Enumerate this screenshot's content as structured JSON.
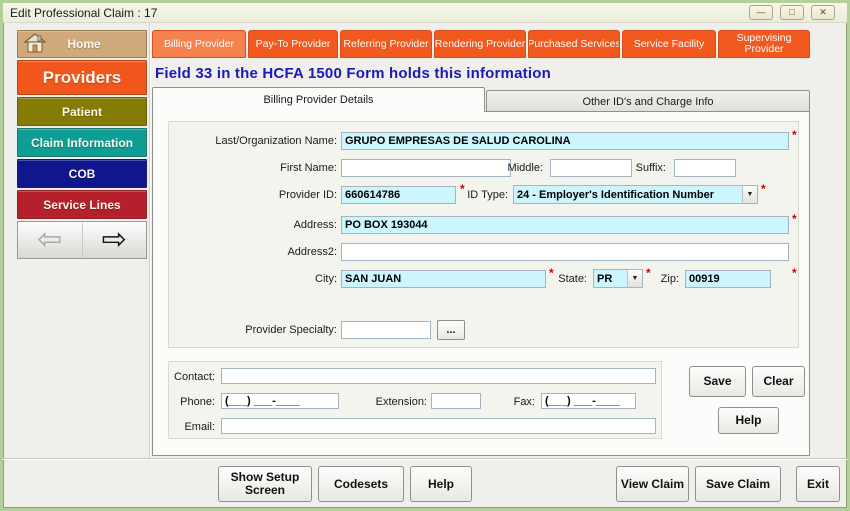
{
  "window": {
    "title": "Edit Professional Claim : 17"
  },
  "icons": {
    "minimize": "—",
    "maximize": "□",
    "close": "✕",
    "back": "⇦",
    "forward": "⇨",
    "dropdown": "▼",
    "home": "home-icon"
  },
  "theme": {
    "tab_active": "#f5814f",
    "tab_inactive": "#f2591e",
    "field_filled": "#ccf5fd",
    "required_color": "#cc0000",
    "note_color": "#1a1ab8"
  },
  "sidebar": {
    "items": [
      {
        "label": "Home",
        "color": "#cfa979"
      },
      {
        "label": "Providers",
        "color": "#f1571c"
      },
      {
        "label": "Patient",
        "color": "#847c04"
      },
      {
        "label": "Claim Information",
        "color": "#0f9e95"
      },
      {
        "label": "COB",
        "color": "#10168e"
      },
      {
        "label": "Service Lines",
        "color": "#b5202c"
      }
    ]
  },
  "provider_tabs": [
    {
      "label": "Billing Provider"
    },
    {
      "label": "Pay-To Provider"
    },
    {
      "label": "Referring Provider"
    },
    {
      "label": "Rendering Provider"
    },
    {
      "label": "Purchased Services"
    },
    {
      "label": "Service Facility"
    },
    {
      "label": "Supervising Provider"
    }
  ],
  "note": "Field 33 in the HCFA 1500 Form holds this information",
  "detail_tabs": [
    {
      "label": "Billing Provider Details"
    },
    {
      "label": "Other ID's and Charge Info"
    }
  ],
  "required_marker": "*",
  "form": {
    "last_org": {
      "label": "Last/Organization Name:",
      "value": "GRUPO EMPRESAS DE SALUD CAROLINA"
    },
    "first_name": {
      "label": "First Name:",
      "value": ""
    },
    "middle": {
      "label": "Middle:",
      "value": ""
    },
    "suffix": {
      "label": "Suffix:",
      "value": ""
    },
    "provider_id": {
      "label": "Provider ID:",
      "value": "660614786"
    },
    "id_type": {
      "label": "ID Type:",
      "value": "24 - Employer's Identification Number"
    },
    "address": {
      "label": "Address:",
      "value": "PO BOX 193044"
    },
    "address2": {
      "label": "Address2:",
      "value": ""
    },
    "city": {
      "label": "City:",
      "value": "SAN JUAN"
    },
    "state": {
      "label": "State:",
      "value": "PR"
    },
    "zip": {
      "label": "Zip:",
      "value": "00919"
    },
    "provider_specialty": {
      "label": "Provider Specialty:",
      "value": "",
      "browse_label": "..."
    },
    "contact": {
      "label": "Contact:",
      "value": ""
    },
    "phone": {
      "label": "Phone:",
      "value": "(___) ___-____"
    },
    "extension": {
      "label": "Extension:",
      "value": ""
    },
    "fax": {
      "label": "Fax:",
      "value": "(___) ___-____"
    },
    "email": {
      "label": "Email:",
      "value": ""
    }
  },
  "actions": {
    "save": "Save",
    "clear": "Clear",
    "help": "Help"
  },
  "bottom": {
    "show_setup": "Show Setup Screen",
    "codesets": "Codesets",
    "help": "Help",
    "view_claim": "View Claim",
    "save_claim": "Save Claim",
    "exit": "Exit"
  }
}
